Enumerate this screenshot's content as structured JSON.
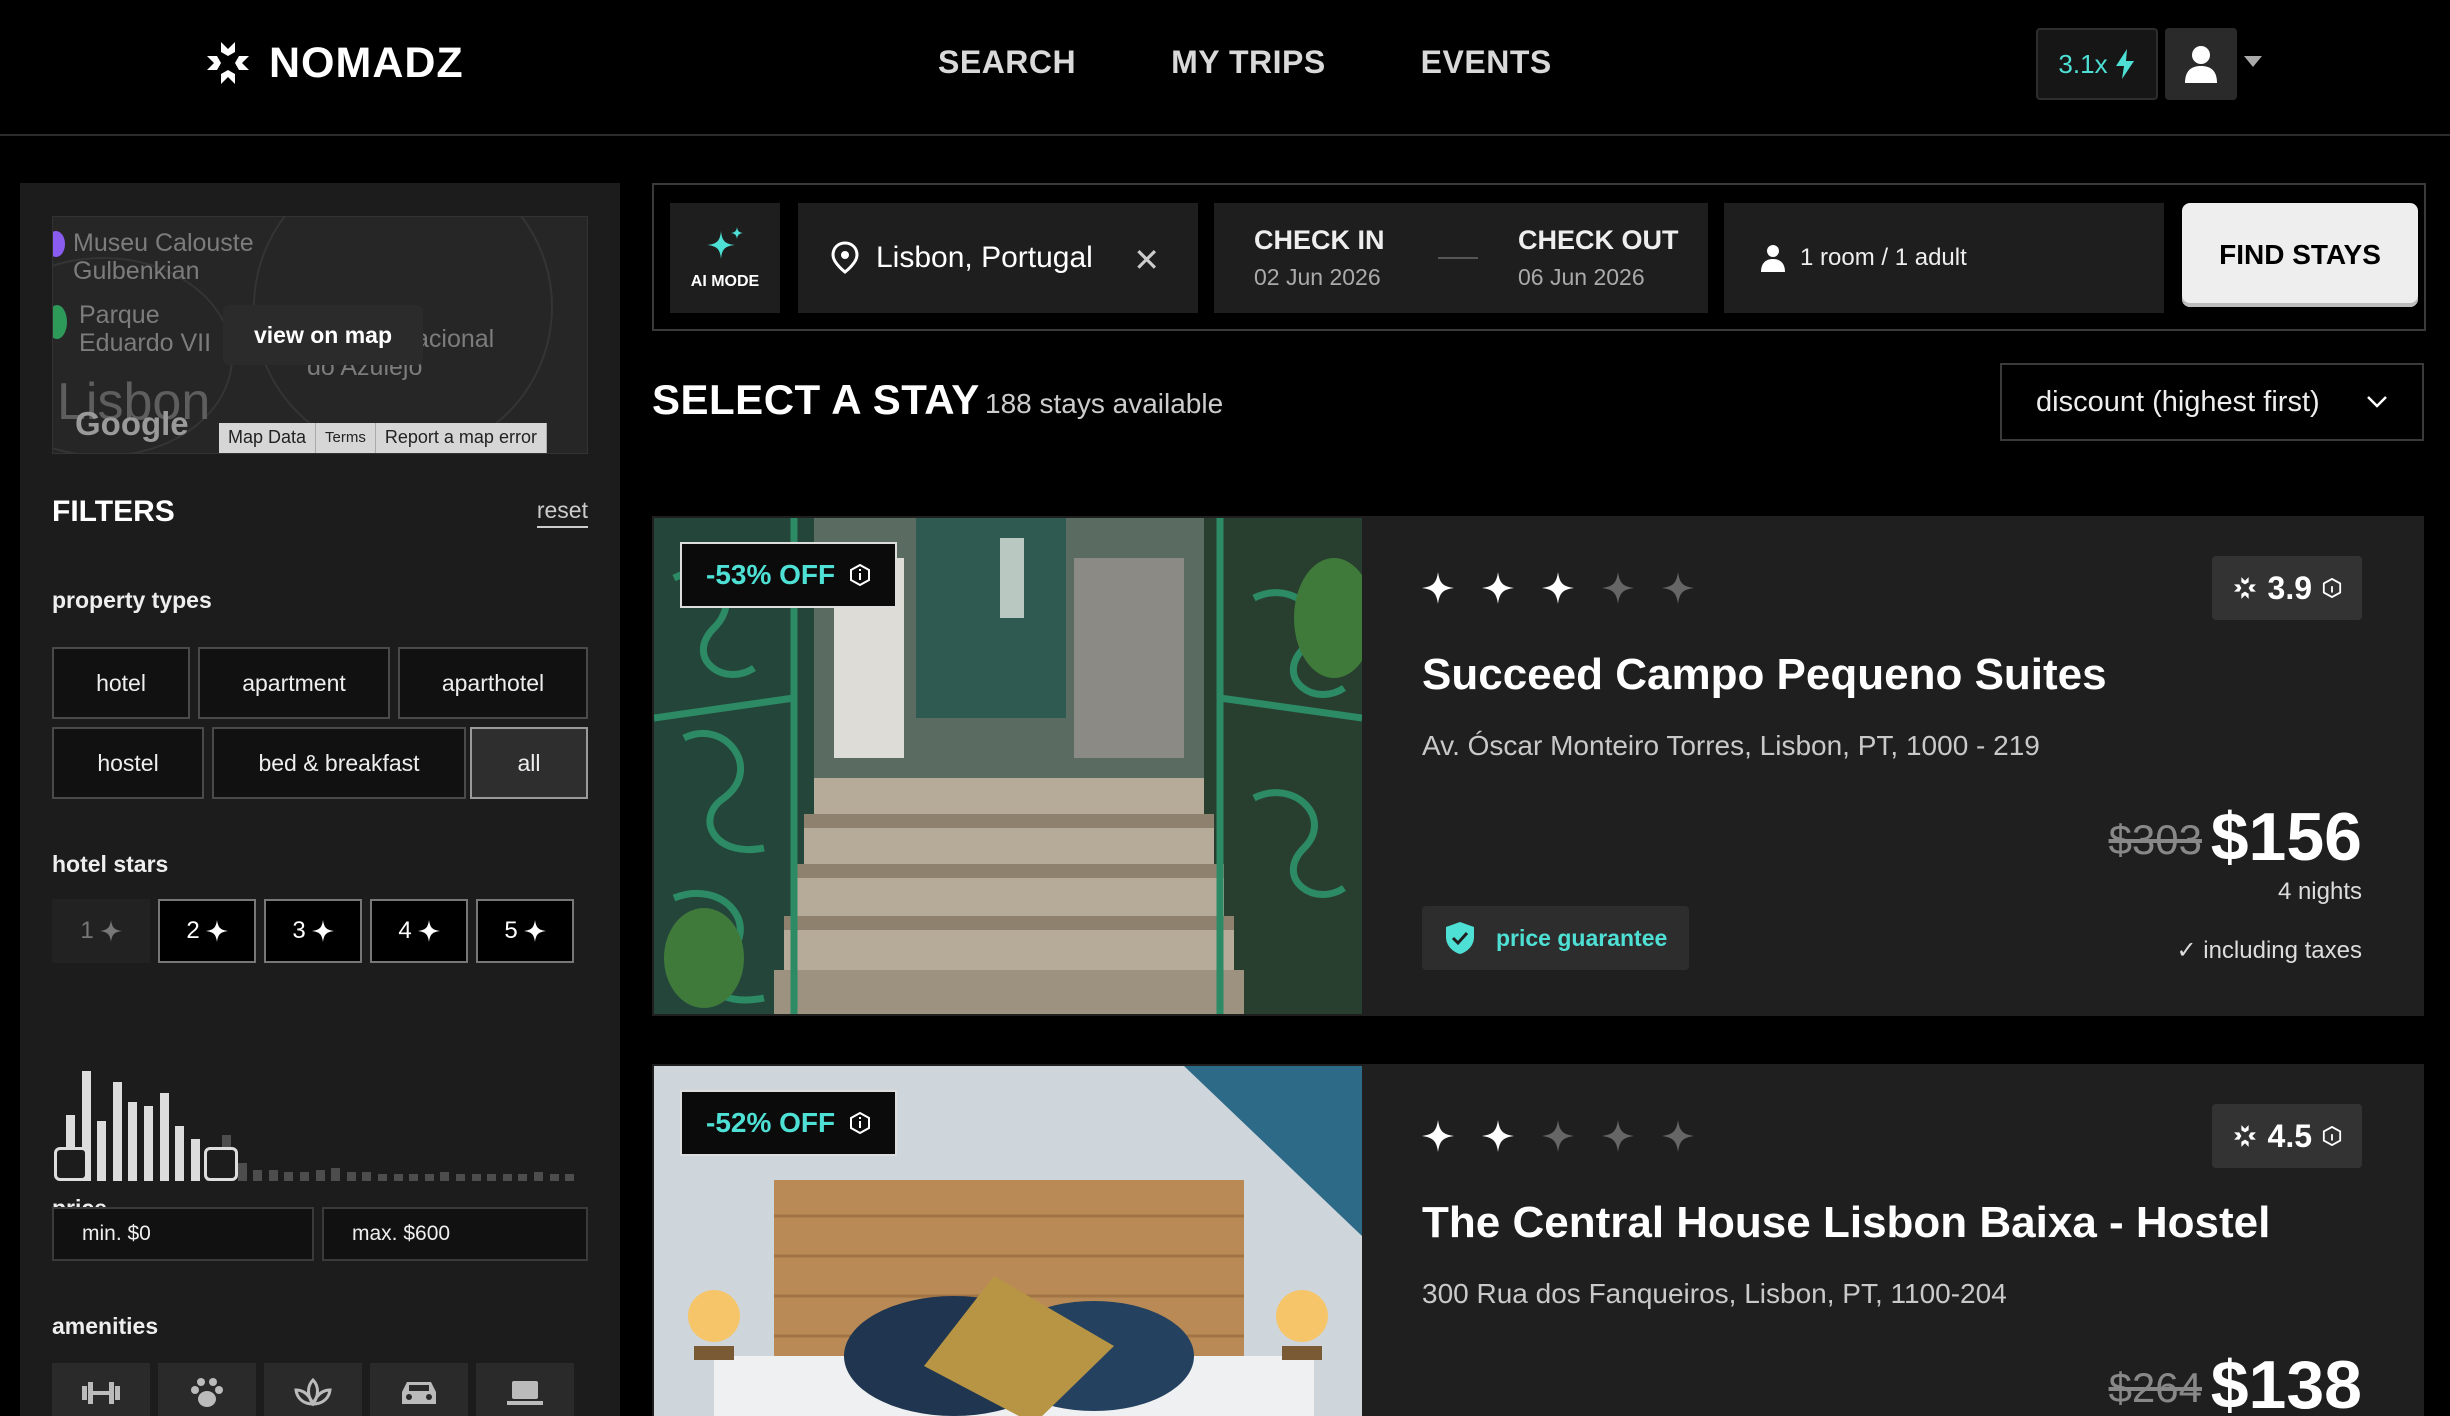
{
  "app": {
    "brand": "NOMADZ"
  },
  "nav": {
    "links": [
      "SEARCH",
      "MY TRIPS",
      "EVENTS"
    ]
  },
  "account": {
    "boost": "3.1x"
  },
  "map": {
    "labels": [
      "Museu Calouste",
      "Gulbenkian",
      "Parque",
      "Eduardo VII",
      "acional",
      "do Azulejo"
    ],
    "city": "Lisbon",
    "google": "Google",
    "view_button": "view on map",
    "attribution": [
      "Map Data",
      "Terms",
      "Report a map error"
    ]
  },
  "filters": {
    "title": "FILTERS",
    "reset": "reset",
    "property_types_label": "property types",
    "property_types": [
      "hotel",
      "apartment",
      "aparthotel",
      "hostel",
      "bed & breakfast",
      "all"
    ],
    "property_selected": "all",
    "stars_label": "hotel stars",
    "stars": [
      "1",
      "2",
      "3",
      "4",
      "5"
    ],
    "price_label": "price",
    "price_min": "min. $0",
    "price_max": "max. $600",
    "histogram": [
      0.6,
      1.0,
      0.55,
      0.9,
      0.72,
      0.68,
      0.8,
      0.5,
      0.38,
      0.12,
      0.42,
      0.16,
      0.1,
      0.1,
      0.08,
      0.08,
      0.1,
      0.12,
      0.08,
      0.08,
      0.06,
      0.06,
      0.06,
      0.06,
      0.08,
      0.06,
      0.06,
      0.06,
      0.06,
      0.06,
      0.08,
      0.06,
      0.06
    ],
    "histogram_selected_until": 9,
    "amenities_label": "amenities",
    "amenities": [
      "dumbbell-icon",
      "paw-icon",
      "spa-icon",
      "car-icon",
      "laptop-icon"
    ]
  },
  "search": {
    "ai_mode": "AI MODE",
    "location": "Lisbon, Portugal",
    "checkin_label": "CHECK IN",
    "checkin": "02 Jun 2026",
    "checkout_label": "CHECK OUT",
    "checkout": "06 Jun 2026",
    "guests": "1 room / 1 adult",
    "find_button": "FIND STAYS"
  },
  "results": {
    "title": "SELECT A STAY",
    "count": "188 stays available",
    "sort": "discount (highest first)"
  },
  "stays": [
    {
      "discount": "-53% OFF",
      "stars": 3,
      "rating": "3.9",
      "name": "Succeed Campo Pequeno Suites",
      "address": "Av. Óscar Monteiro Torres, Lisbon, PT, 1000 - 219",
      "old_price": "$303",
      "price": "$156",
      "nights": "4 nights",
      "taxes": "including taxes",
      "guarantee": "price guarantee"
    },
    {
      "discount": "-52% OFF",
      "stars": 2,
      "rating": "4.5",
      "name": "The Central House Lisbon Baixa - Hostel",
      "address": "300 Rua dos Fanqueiros, Lisbon, PT, 1100-204",
      "old_price": "$264",
      "price": "$138"
    }
  ]
}
